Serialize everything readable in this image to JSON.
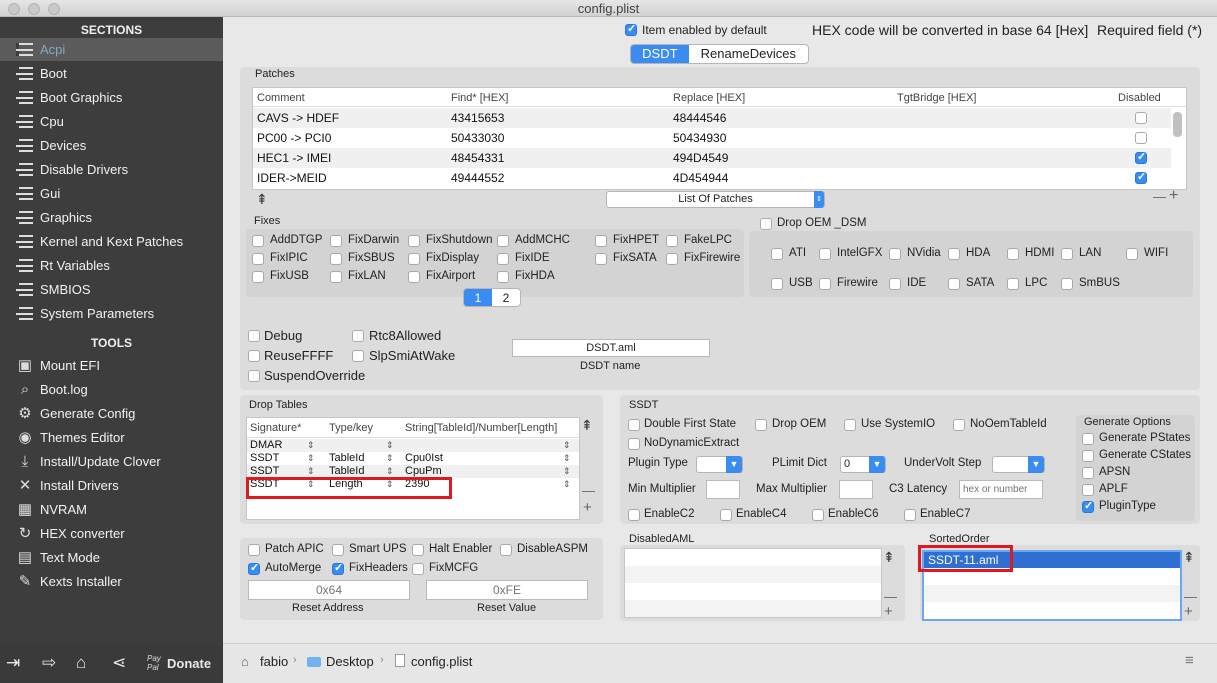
{
  "window": {
    "title": "config.plist"
  },
  "sidebar": {
    "sections_header": "SECTIONS",
    "sections": [
      "Acpi",
      "Boot",
      "Boot Graphics",
      "Cpu",
      "Devices",
      "Disable Drivers",
      "Gui",
      "Graphics",
      "Kernel and Kext Patches",
      "Rt Variables",
      "SMBIOS",
      "System Parameters"
    ],
    "tools_header": "TOOLS",
    "tools": [
      {
        "label": "Mount EFI",
        "icon": "disk-icon"
      },
      {
        "label": "Boot.log",
        "icon": "log-icon"
      },
      {
        "label": "Generate Config",
        "icon": "gears-icon"
      },
      {
        "label": "Themes Editor",
        "icon": "palette-icon"
      },
      {
        "label": "Install/Update Clover",
        "icon": "download-icon"
      },
      {
        "label": "Install Drivers",
        "icon": "tools-icon"
      },
      {
        "label": "NVRAM",
        "icon": "chip-icon"
      },
      {
        "label": "HEX converter",
        "icon": "refresh-icon"
      },
      {
        "label": "Text Mode",
        "icon": "text-icon"
      },
      {
        "label": "Kexts Installer",
        "icon": "wrench-icon"
      }
    ],
    "bottom": {
      "donate_label": "Donate",
      "paypal_label": "Pay Pal"
    }
  },
  "header": {
    "item_enabled_label": "Item enabled by default",
    "hex_note": "HEX code will be converted in base 64 [Hex]",
    "required_note": "Required field (*)",
    "tabs": [
      "DSDT",
      "RenameDevices"
    ]
  },
  "patches": {
    "title": "Patches",
    "columns": [
      "Comment",
      "Find* [HEX]",
      "Replace [HEX]",
      "TgtBridge [HEX]",
      "Disabled"
    ],
    "rows": [
      {
        "comment": "CAVS -> HDEF",
        "find": "43415653",
        "replace": "48444546",
        "tgt": "",
        "disabled": false
      },
      {
        "comment": "PC00 -> PCI0",
        "find": "50433030",
        "replace": "50434930",
        "tgt": "",
        "disabled": false
      },
      {
        "comment": "HEC1 -> IMEI",
        "find": "48454331",
        "replace": "494D4549",
        "tgt": "",
        "disabled": true
      },
      {
        "comment": "IDER->MEID",
        "find": "49444552",
        "replace": "4D454944",
        "tgt": "",
        "disabled": true
      }
    ],
    "list_popup": "List Of Patches",
    "minus": "—",
    "plus": "+"
  },
  "fixes": {
    "title": "Fixes",
    "items": [
      {
        "label": "AddDTGP",
        "checked": false
      },
      {
        "label": "FixDarwin",
        "checked": false
      },
      {
        "label": "FixShutdown",
        "checked": false
      },
      {
        "label": "AddMCHC",
        "checked": false
      },
      {
        "label": "FixHPET",
        "checked": false
      },
      {
        "label": "FakeLPC",
        "checked": false
      },
      {
        "label": "FixIPIC",
        "checked": false
      },
      {
        "label": "FixSBUS",
        "checked": false
      },
      {
        "label": "FixDisplay",
        "checked": false
      },
      {
        "label": "FixIDE",
        "checked": false
      },
      {
        "label": "FixSATA",
        "checked": false
      },
      {
        "label": "FixFirewire",
        "checked": false
      },
      {
        "label": "FixUSB",
        "checked": false
      },
      {
        "label": "FixLAN",
        "checked": false
      },
      {
        "label": "FixAirport",
        "checked": false
      },
      {
        "label": "FixHDA",
        "checked": false
      }
    ],
    "pages": [
      "1",
      "2"
    ]
  },
  "drop_oem_dsm": {
    "title": "Drop OEM _DSM",
    "items": [
      {
        "label": "ATI"
      },
      {
        "label": "IntelGFX"
      },
      {
        "label": "NVidia"
      },
      {
        "label": "HDA"
      },
      {
        "label": "HDMI"
      },
      {
        "label": "LAN"
      },
      {
        "label": "WIFI"
      },
      {
        "label": "USB"
      },
      {
        "label": "Firewire"
      },
      {
        "label": "IDE"
      },
      {
        "label": "SATA"
      },
      {
        "label": "LPC"
      },
      {
        "label": "SmBUS"
      }
    ]
  },
  "options": {
    "debug": "Debug",
    "rtc8": "Rtc8Allowed",
    "reusefff": "ReuseFFFF",
    "slpsmi": "SlpSmiAtWake",
    "suspend": "SuspendOverride",
    "dsdt_name_value": "DSDT.aml",
    "dsdt_name_label": "DSDT name"
  },
  "drop_tables": {
    "title": "Drop Tables",
    "columns": [
      "Signature*",
      "Type/key",
      "String[TableId]/Number[Length]"
    ],
    "rows": [
      {
        "sig": "DMAR",
        "type": "",
        "val": ""
      },
      {
        "sig": "SSDT",
        "type": "TableId",
        "val": "Cpu0Ist"
      },
      {
        "sig": "SSDT",
        "type": "TableId",
        "val": "CpuPm"
      },
      {
        "sig": "SSDT",
        "type": "Length",
        "val": "2390"
      }
    ]
  },
  "ssdt": {
    "title": "SSDT",
    "double_first_state": "Double First State",
    "drop_oem": "Drop OEM",
    "use_system_io": "Use SystemIO",
    "no_oem_table_id": "NoOemTableId",
    "no_dynamic_extract": "NoDynamicExtract",
    "plugin_type": "Plugin Type",
    "plimit_dict": "PLimit Dict",
    "plimit_value": "0",
    "undervolt_step": "UnderVolt Step",
    "min_multiplier": "Min Multiplier",
    "max_multiplier": "Max Multiplier",
    "c3_latency": "C3 Latency",
    "c3_placeholder": "hex or number",
    "enable_c2": "EnableC2",
    "enable_c4": "EnableC4",
    "enable_c6": "EnableC6",
    "enable_c7": "EnableC7",
    "generate_options": {
      "title": "Generate Options",
      "items": [
        {
          "label": "Generate PStates",
          "checked": false
        },
        {
          "label": "Generate CStates",
          "checked": false
        },
        {
          "label": "APSN",
          "checked": false
        },
        {
          "label": "APLF",
          "checked": false
        },
        {
          "label": "PluginType",
          "checked": true
        }
      ]
    }
  },
  "misc": {
    "patch_apic": "Patch APIC",
    "smart_ups": "Smart UPS",
    "halt_enabler": "Halt Enabler",
    "disable_aspm": "DisableASPM",
    "auto_merge": "AutoMerge",
    "fix_headers": "FixHeaders",
    "fix_mcfg": "FixMCFG",
    "reset_address_placeholder": "0x64",
    "reset_address_label": "Reset Address",
    "reset_value_placeholder": "0xFE",
    "reset_value_label": "Reset Value"
  },
  "disabled_aml": {
    "title": "DisabledAML"
  },
  "sorted_order": {
    "title": "SortedOrder",
    "items": [
      "SSDT-11.aml"
    ]
  },
  "status_bar": {
    "path": [
      "fabio",
      "Desktop",
      "config.plist"
    ]
  }
}
